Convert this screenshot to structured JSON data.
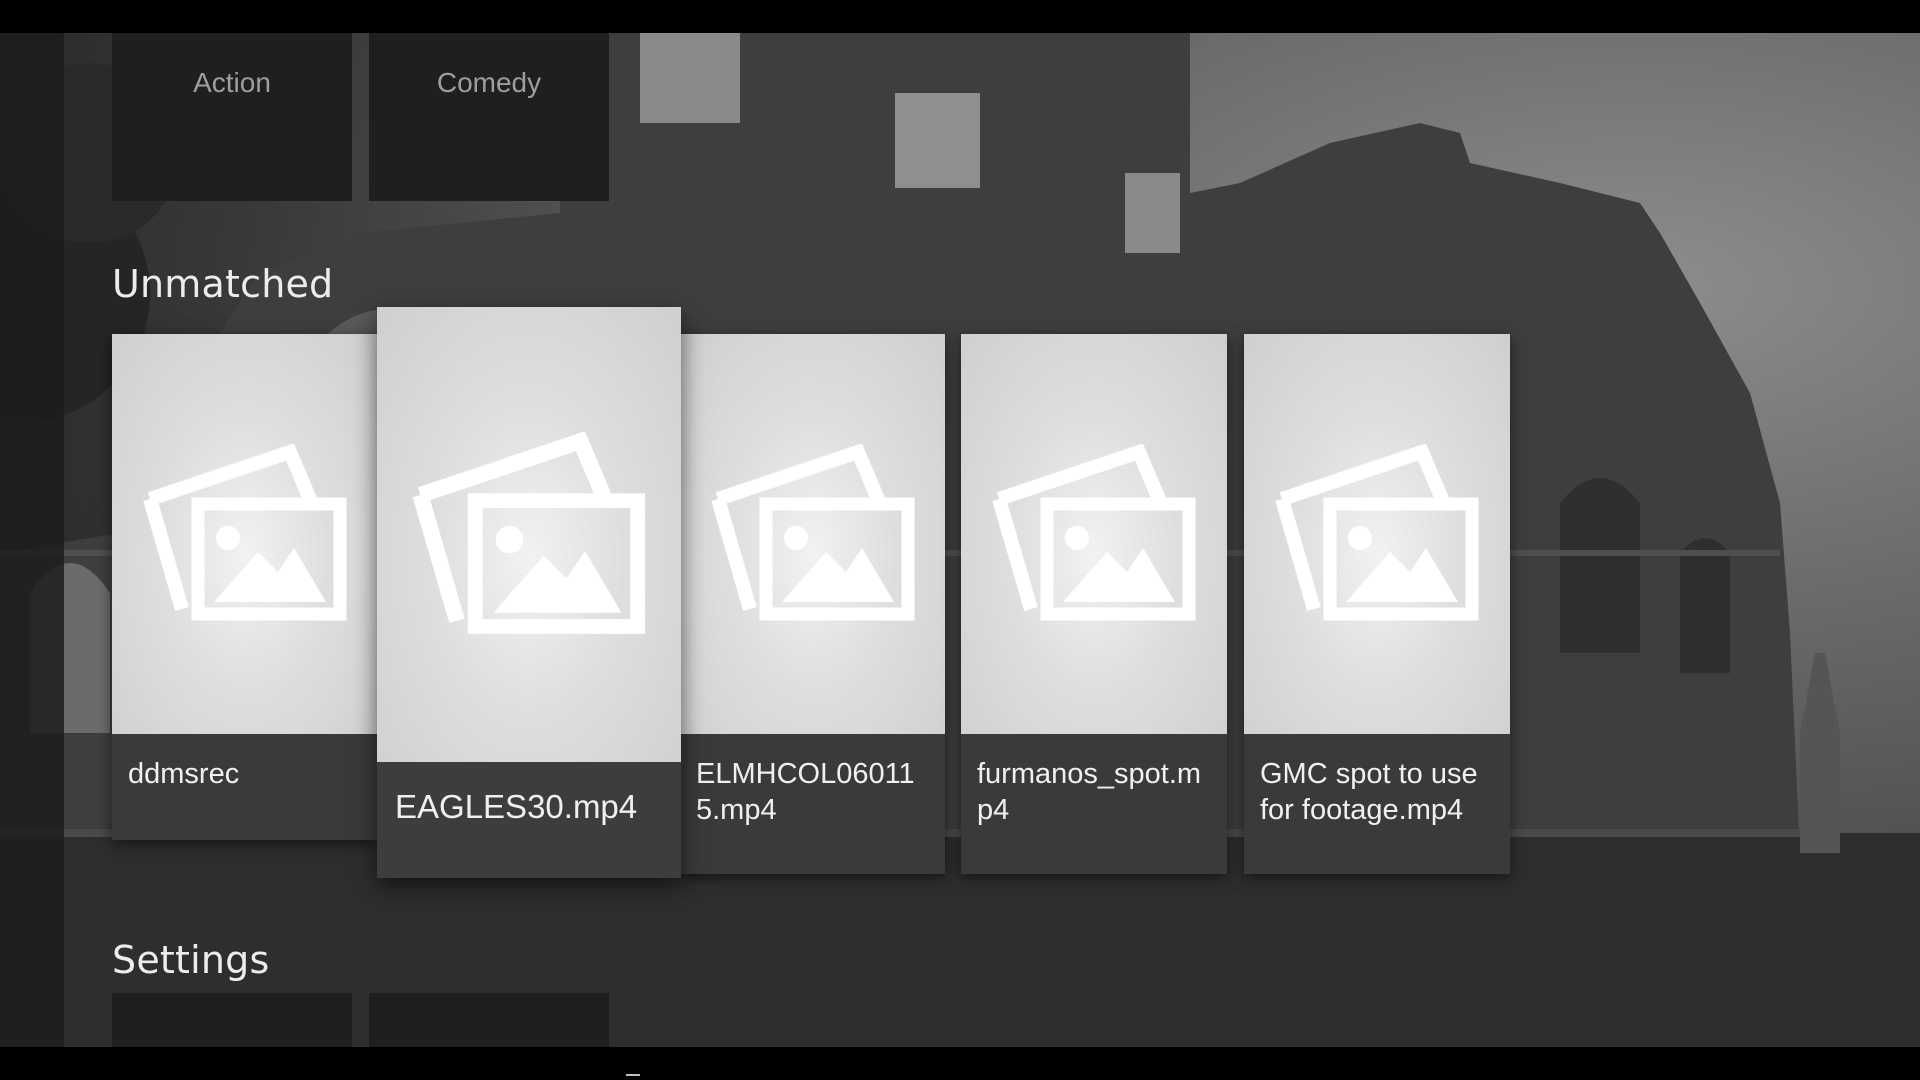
{
  "genres": {
    "items": [
      {
        "label": "Action"
      },
      {
        "label": "Comedy"
      }
    ]
  },
  "unmatched": {
    "title": "Unmatched",
    "cards": [
      {
        "label": "ddmsrec",
        "icon": "image-placeholder-icon"
      },
      {
        "label": "EAGLES30.mp4",
        "icon": "image-placeholder-icon"
      },
      {
        "label": "ELMHCOL060115.mp4",
        "icon": "image-placeholder-icon"
      },
      {
        "label": "furmanos_spot.mp4",
        "icon": "image-placeholder-icon"
      },
      {
        "label": "GMC spot to use for footage.mp4",
        "icon": "image-placeholder-icon"
      }
    ]
  },
  "settings": {
    "title": "Settings"
  },
  "colors": {
    "card_label_bg": "#3a3a3a",
    "genre_card_bg": "#1f1f1f",
    "text_primary": "#f0f0f0",
    "text_muted": "#9e9e9e"
  }
}
